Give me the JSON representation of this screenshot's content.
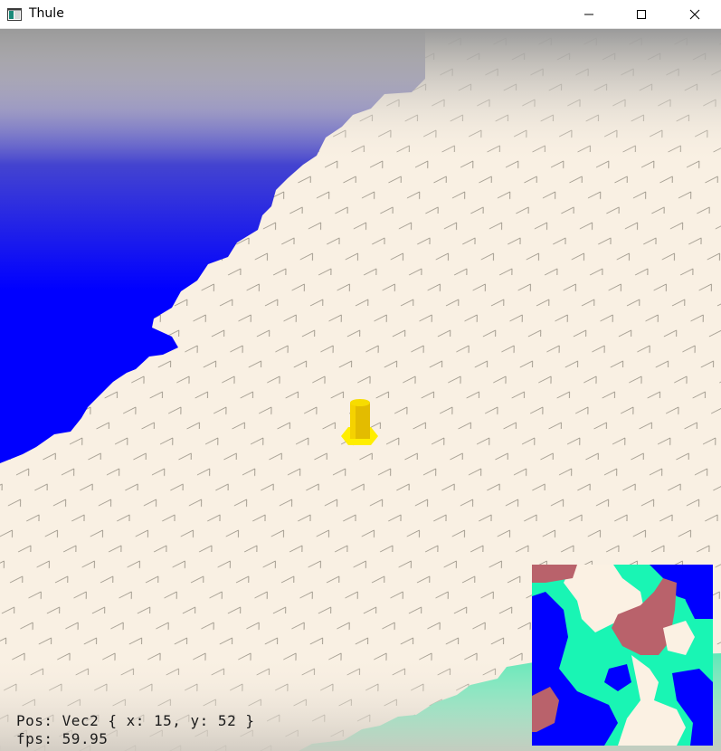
{
  "window": {
    "title": "Thule",
    "icon": "app-window-icon",
    "controls": [
      "minimize-icon",
      "maximize-icon",
      "close-icon"
    ]
  },
  "hud": {
    "pos_label": "Pos:",
    "pos_value": "Vec2 { x: 15, y: 52 }",
    "fps_label": "fps:",
    "fps_value": "59.95"
  },
  "colors": {
    "sand": "#f9f0e3",
    "water": "#0000ff",
    "grass": "#5ee8b7",
    "mountain": "#b9626b",
    "player": "#e8c200",
    "player_base": "#ffee00"
  },
  "minimap": {
    "legend_colors": [
      "#0000ff",
      "#19f5b4",
      "#b9626b",
      "#fbf1e3"
    ]
  }
}
